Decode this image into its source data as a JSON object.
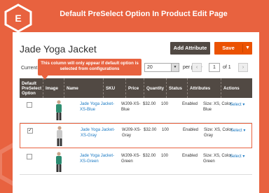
{
  "banner": {
    "title": "Default PreSelect Option In Product Edit Page"
  },
  "page": {
    "title": "Jade Yoga Jacket"
  },
  "toolbar": {
    "add_attribute": "Add Attribute",
    "save": "Save"
  },
  "grid_controls": {
    "current_label": "Current",
    "per_page_value": "20",
    "per_page_label": "per page",
    "page_input": "1",
    "page_of": "of 1"
  },
  "callout": {
    "text": "This column will only appear if default option is selected from configurations"
  },
  "columns": [
    "Default PreSelect Option",
    "Image",
    "Name",
    "SKU",
    "Price",
    "Quantity",
    "Status",
    "Attributes",
    "Actions"
  ],
  "rows": [
    {
      "checked": false,
      "name": "Jade Yoga Jacket-XS-Blue",
      "sku": "WJ09-XS-Blue",
      "price": "$32.00",
      "qty": "100",
      "status": "Enabled",
      "attributes": "Size: XS, Color: Blue",
      "action": "Select",
      "shirt": "#2f8f72"
    },
    {
      "checked": true,
      "name": "Jade Yoga Jacket-XS-Gray",
      "sku": "WJ09-XS-Gray",
      "price": "$32.00",
      "qty": "100",
      "status": "Enabled",
      "attributes": "Size: XS, Color: Gray",
      "action": "Select",
      "shirt": "#c9c9c9"
    },
    {
      "checked": false,
      "name": "Jade Yoga Jacket-XS-Green",
      "sku": "WJ09-XS-Green",
      "price": "$32.00",
      "qty": "100",
      "status": "Enabled",
      "attributes": "Size: XS, Color: Green",
      "action": "Select",
      "shirt": "#2a8a70"
    }
  ],
  "colors": {
    "brand": "#e8623f",
    "header": "#514943",
    "link": "#1979c3",
    "save": "#eb5202"
  }
}
